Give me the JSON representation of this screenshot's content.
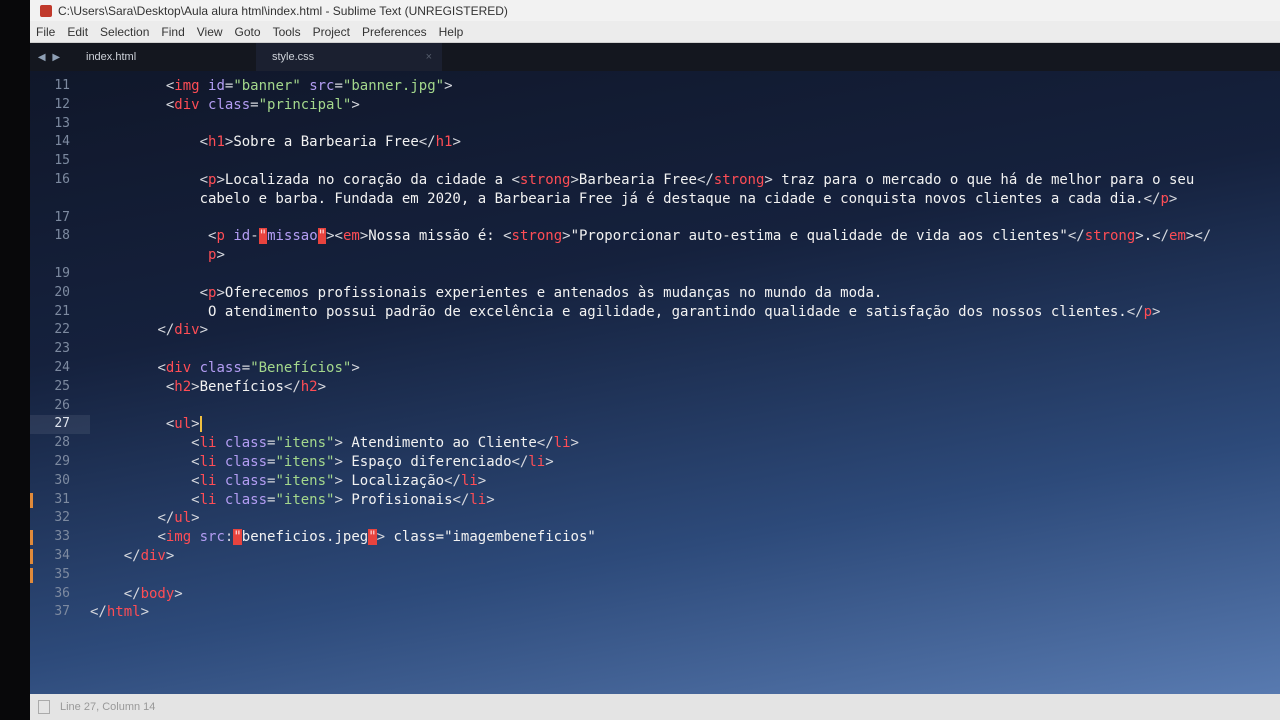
{
  "window": {
    "title": "C:\\Users\\Sara\\Desktop\\Aula alura html\\index.html - Sublime Text (UNREGISTERED)"
  },
  "menu": [
    "File",
    "Edit",
    "Selection",
    "Find",
    "View",
    "Goto",
    "Tools",
    "Project",
    "Preferences",
    "Help"
  ],
  "tabs": [
    {
      "label": "index.html",
      "active": false
    },
    {
      "label": "style.css",
      "active": true,
      "close": "×"
    }
  ],
  "status": {
    "position": "Line 27, Column 14"
  },
  "colors": {
    "tag": "#ff4d55",
    "attr": "#b39df3",
    "string": "#a4d88c",
    "error_bg": "#e8433e",
    "modified_marker": "#e08a3a"
  },
  "editor": {
    "current_line": "27",
    "lines": [
      {
        "n": "11",
        "tokens": [
          [
            "x",
            "         "
          ],
          [
            "p",
            "<"
          ],
          [
            "t",
            "img"
          ],
          [
            "a",
            " id"
          ],
          [
            "p",
            "="
          ],
          [
            "s",
            "\"banner\""
          ],
          [
            "a",
            " src"
          ],
          [
            "p",
            "="
          ],
          [
            "s",
            "\"banner.jpg\""
          ],
          [
            "p",
            ">"
          ]
        ]
      },
      {
        "n": "12",
        "tokens": [
          [
            "x",
            "         "
          ],
          [
            "p",
            "<"
          ],
          [
            "t",
            "div"
          ],
          [
            "a",
            " class"
          ],
          [
            "p",
            "="
          ],
          [
            "s",
            "\"principal\""
          ],
          [
            "p",
            ">"
          ]
        ]
      },
      {
        "n": "13",
        "tokens": []
      },
      {
        "n": "14",
        "tokens": [
          [
            "x",
            "             "
          ],
          [
            "p",
            "<"
          ],
          [
            "t",
            "h1"
          ],
          [
            "p",
            ">"
          ],
          [
            "x",
            "Sobre a Barbearia Free"
          ],
          [
            "p",
            "</"
          ],
          [
            "t",
            "h1"
          ],
          [
            "p",
            ">"
          ]
        ]
      },
      {
        "n": "15",
        "tokens": []
      },
      {
        "n": "16",
        "tokens": [
          [
            "x",
            "             "
          ],
          [
            "p",
            "<"
          ],
          [
            "t",
            "p"
          ],
          [
            "p",
            ">"
          ],
          [
            "x",
            "Localizada no coração da cidade a "
          ],
          [
            "p",
            "<"
          ],
          [
            "t",
            "strong"
          ],
          [
            "p",
            ">"
          ],
          [
            "x",
            "Barbearia Free"
          ],
          [
            "p",
            "</"
          ],
          [
            "t",
            "strong"
          ],
          [
            "p",
            ">"
          ],
          [
            "x",
            " traz para o mercado o que há de melhor para o seu"
          ]
        ]
      },
      {
        "n": "",
        "tokens": [
          [
            "x",
            "             cabelo e barba. Fundada em 2020, a Barbearia Free já é destaque na cidade e conquista novos clientes a cada dia."
          ],
          [
            "p",
            "</"
          ],
          [
            "t",
            "p"
          ],
          [
            "p",
            ">"
          ]
        ]
      },
      {
        "n": "17",
        "tokens": []
      },
      {
        "n": "18",
        "tokens": [
          [
            "x",
            "              "
          ],
          [
            "p",
            "<"
          ],
          [
            "t",
            "p"
          ],
          [
            "a",
            " id"
          ],
          [
            "p",
            "-"
          ],
          [
            "e",
            "\""
          ],
          [
            "a",
            "missao"
          ],
          [
            "e",
            "\""
          ],
          [
            "p",
            ">"
          ],
          [
            "p",
            "<"
          ],
          [
            "t",
            "em"
          ],
          [
            "p",
            ">"
          ],
          [
            "x",
            "Nossa missão é: "
          ],
          [
            "p",
            "<"
          ],
          [
            "t",
            "strong"
          ],
          [
            "p",
            ">"
          ],
          [
            "x",
            "\"Proporcionar auto-estima e qualidade de vida aos clientes\""
          ],
          [
            "p",
            "</"
          ],
          [
            "t",
            "strong"
          ],
          [
            "p",
            ">"
          ],
          [
            "x",
            "."
          ],
          [
            "p",
            "</"
          ],
          [
            "t",
            "em"
          ],
          [
            "p",
            ">"
          ],
          [
            "p",
            "</"
          ]
        ]
      },
      {
        "n": "",
        "tokens": [
          [
            "x",
            "              "
          ],
          [
            "t",
            "p"
          ],
          [
            "p",
            ">"
          ]
        ]
      },
      {
        "n": "19",
        "tokens": []
      },
      {
        "n": "20",
        "tokens": [
          [
            "x",
            "             "
          ],
          [
            "p",
            "<"
          ],
          [
            "t",
            "p"
          ],
          [
            "p",
            ">"
          ],
          [
            "x",
            "Oferecemos profissionais experientes e antenados às mudanças no mundo da moda."
          ]
        ]
      },
      {
        "n": "21",
        "tokens": [
          [
            "x",
            "              O atendimento possui padrão de excelência e agilidade, garantindo qualidade e satisfação dos nossos clientes."
          ],
          [
            "p",
            "</"
          ],
          [
            "t",
            "p"
          ],
          [
            "p",
            ">"
          ]
        ]
      },
      {
        "n": "22",
        "tokens": [
          [
            "x",
            "        "
          ],
          [
            "p",
            "</"
          ],
          [
            "t",
            "div"
          ],
          [
            "p",
            ">"
          ]
        ]
      },
      {
        "n": "23",
        "tokens": []
      },
      {
        "n": "24",
        "tokens": [
          [
            "x",
            "        "
          ],
          [
            "p",
            "<"
          ],
          [
            "t",
            "div"
          ],
          [
            "a",
            " class"
          ],
          [
            "p",
            "="
          ],
          [
            "s",
            "\"Benefícios\""
          ],
          [
            "p",
            ">"
          ]
        ]
      },
      {
        "n": "25",
        "tokens": [
          [
            "x",
            "         "
          ],
          [
            "p",
            "<"
          ],
          [
            "t",
            "h2"
          ],
          [
            "p",
            ">"
          ],
          [
            "x",
            "Benefícios"
          ],
          [
            "p",
            "</"
          ],
          [
            "t",
            "h2"
          ],
          [
            "p",
            ">"
          ]
        ]
      },
      {
        "n": "26",
        "tokens": []
      },
      {
        "n": "27",
        "cursor": true,
        "tokens": [
          [
            "x",
            "         "
          ],
          [
            "p",
            "<"
          ],
          [
            "t",
            "ul"
          ],
          [
            "p",
            ">"
          ]
        ]
      },
      {
        "n": "28",
        "tokens": [
          [
            "x",
            "            "
          ],
          [
            "p",
            "<"
          ],
          [
            "t",
            "li"
          ],
          [
            "a",
            " class"
          ],
          [
            "p",
            "="
          ],
          [
            "s",
            "\"itens\""
          ],
          [
            "p",
            ">"
          ],
          [
            "x",
            " Atendimento ao Cliente"
          ],
          [
            "p",
            "</"
          ],
          [
            "t",
            "li"
          ],
          [
            "p",
            ">"
          ]
        ]
      },
      {
        "n": "29",
        "tokens": [
          [
            "x",
            "            "
          ],
          [
            "p",
            "<"
          ],
          [
            "t",
            "li"
          ],
          [
            "a",
            " class"
          ],
          [
            "p",
            "="
          ],
          [
            "s",
            "\"itens\""
          ],
          [
            "p",
            ">"
          ],
          [
            "x",
            " Espaço diferenciado"
          ],
          [
            "p",
            "</"
          ],
          [
            "t",
            "li"
          ],
          [
            "p",
            ">"
          ]
        ]
      },
      {
        "n": "30",
        "tokens": [
          [
            "x",
            "            "
          ],
          [
            "p",
            "<"
          ],
          [
            "t",
            "li"
          ],
          [
            "a",
            " class"
          ],
          [
            "p",
            "="
          ],
          [
            "s",
            "\"itens\""
          ],
          [
            "p",
            ">"
          ],
          [
            "x",
            " Localização"
          ],
          [
            "p",
            "</"
          ],
          [
            "t",
            "li"
          ],
          [
            "p",
            ">"
          ]
        ]
      },
      {
        "n": "31",
        "modified": true,
        "tokens": [
          [
            "x",
            "            "
          ],
          [
            "p",
            "<"
          ],
          [
            "t",
            "li"
          ],
          [
            "a",
            " class"
          ],
          [
            "p",
            "="
          ],
          [
            "s",
            "\"itens\""
          ],
          [
            "p",
            ">"
          ],
          [
            "x",
            " Profisionais"
          ],
          [
            "p",
            "</"
          ],
          [
            "t",
            "li"
          ],
          [
            "p",
            ">"
          ]
        ]
      },
      {
        "n": "32",
        "tokens": [
          [
            "x",
            "        "
          ],
          [
            "p",
            "</"
          ],
          [
            "t",
            "ul"
          ],
          [
            "p",
            ">"
          ]
        ]
      },
      {
        "n": "33",
        "modified": true,
        "tokens": [
          [
            "x",
            "        "
          ],
          [
            "p",
            "<"
          ],
          [
            "t",
            "img"
          ],
          [
            "a",
            " src"
          ],
          [
            "p",
            ":"
          ],
          [
            "e",
            "\""
          ],
          [
            "x",
            "beneficios.jpeg"
          ],
          [
            "e",
            "\""
          ],
          [
            "p",
            ">"
          ],
          [
            "x",
            " class=\"imagembeneficios\""
          ]
        ]
      },
      {
        "n": "34",
        "modified": true,
        "tokens": [
          [
            "x",
            "    "
          ],
          [
            "p",
            "</"
          ],
          [
            "t",
            "div"
          ],
          [
            "p",
            ">"
          ]
        ]
      },
      {
        "n": "35",
        "modified": true,
        "tokens": []
      },
      {
        "n": "36",
        "tokens": [
          [
            "x",
            "    "
          ],
          [
            "p",
            "</"
          ],
          [
            "t",
            "body"
          ],
          [
            "p",
            ">"
          ]
        ]
      },
      {
        "n": "37",
        "tokens": [
          [
            "p",
            "</"
          ],
          [
            "t",
            "html"
          ],
          [
            "p",
            ">"
          ]
        ]
      }
    ]
  }
}
